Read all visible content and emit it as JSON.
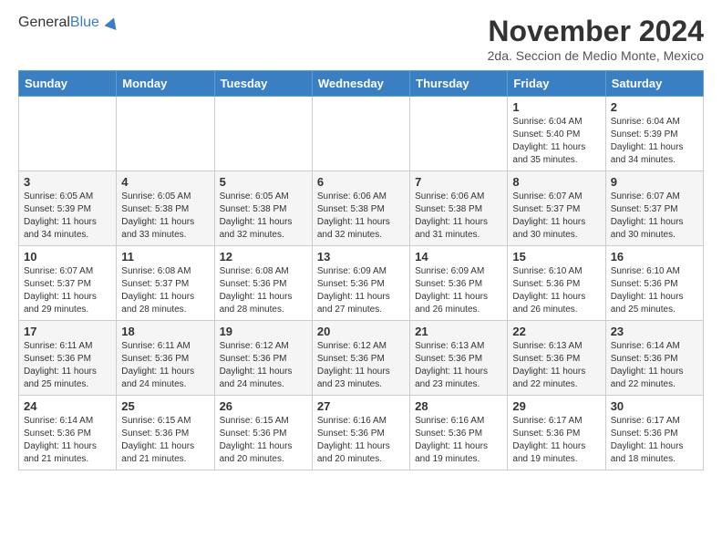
{
  "logo": {
    "general": "General",
    "blue": "Blue"
  },
  "header": {
    "month_title": "November 2024",
    "subtitle": "2da. Seccion de Medio Monte, Mexico"
  },
  "weekdays": [
    "Sunday",
    "Monday",
    "Tuesday",
    "Wednesday",
    "Thursday",
    "Friday",
    "Saturday"
  ],
  "weeks": [
    [
      {
        "day": "",
        "info": ""
      },
      {
        "day": "",
        "info": ""
      },
      {
        "day": "",
        "info": ""
      },
      {
        "day": "",
        "info": ""
      },
      {
        "day": "",
        "info": ""
      },
      {
        "day": "1",
        "info": "Sunrise: 6:04 AM\nSunset: 5:40 PM\nDaylight: 11 hours\nand 35 minutes."
      },
      {
        "day": "2",
        "info": "Sunrise: 6:04 AM\nSunset: 5:39 PM\nDaylight: 11 hours\nand 34 minutes."
      }
    ],
    [
      {
        "day": "3",
        "info": "Sunrise: 6:05 AM\nSunset: 5:39 PM\nDaylight: 11 hours\nand 34 minutes."
      },
      {
        "day": "4",
        "info": "Sunrise: 6:05 AM\nSunset: 5:38 PM\nDaylight: 11 hours\nand 33 minutes."
      },
      {
        "day": "5",
        "info": "Sunrise: 6:05 AM\nSunset: 5:38 PM\nDaylight: 11 hours\nand 32 minutes."
      },
      {
        "day": "6",
        "info": "Sunrise: 6:06 AM\nSunset: 5:38 PM\nDaylight: 11 hours\nand 32 minutes."
      },
      {
        "day": "7",
        "info": "Sunrise: 6:06 AM\nSunset: 5:38 PM\nDaylight: 11 hours\nand 31 minutes."
      },
      {
        "day": "8",
        "info": "Sunrise: 6:07 AM\nSunset: 5:37 PM\nDaylight: 11 hours\nand 30 minutes."
      },
      {
        "day": "9",
        "info": "Sunrise: 6:07 AM\nSunset: 5:37 PM\nDaylight: 11 hours\nand 30 minutes."
      }
    ],
    [
      {
        "day": "10",
        "info": "Sunrise: 6:07 AM\nSunset: 5:37 PM\nDaylight: 11 hours\nand 29 minutes."
      },
      {
        "day": "11",
        "info": "Sunrise: 6:08 AM\nSunset: 5:37 PM\nDaylight: 11 hours\nand 28 minutes."
      },
      {
        "day": "12",
        "info": "Sunrise: 6:08 AM\nSunset: 5:36 PM\nDaylight: 11 hours\nand 28 minutes."
      },
      {
        "day": "13",
        "info": "Sunrise: 6:09 AM\nSunset: 5:36 PM\nDaylight: 11 hours\nand 27 minutes."
      },
      {
        "day": "14",
        "info": "Sunrise: 6:09 AM\nSunset: 5:36 PM\nDaylight: 11 hours\nand 26 minutes."
      },
      {
        "day": "15",
        "info": "Sunrise: 6:10 AM\nSunset: 5:36 PM\nDaylight: 11 hours\nand 26 minutes."
      },
      {
        "day": "16",
        "info": "Sunrise: 6:10 AM\nSunset: 5:36 PM\nDaylight: 11 hours\nand 25 minutes."
      }
    ],
    [
      {
        "day": "17",
        "info": "Sunrise: 6:11 AM\nSunset: 5:36 PM\nDaylight: 11 hours\nand 25 minutes."
      },
      {
        "day": "18",
        "info": "Sunrise: 6:11 AM\nSunset: 5:36 PM\nDaylight: 11 hours\nand 24 minutes."
      },
      {
        "day": "19",
        "info": "Sunrise: 6:12 AM\nSunset: 5:36 PM\nDaylight: 11 hours\nand 24 minutes."
      },
      {
        "day": "20",
        "info": "Sunrise: 6:12 AM\nSunset: 5:36 PM\nDaylight: 11 hours\nand 23 minutes."
      },
      {
        "day": "21",
        "info": "Sunrise: 6:13 AM\nSunset: 5:36 PM\nDaylight: 11 hours\nand 23 minutes."
      },
      {
        "day": "22",
        "info": "Sunrise: 6:13 AM\nSunset: 5:36 PM\nDaylight: 11 hours\nand 22 minutes."
      },
      {
        "day": "23",
        "info": "Sunrise: 6:14 AM\nSunset: 5:36 PM\nDaylight: 11 hours\nand 22 minutes."
      }
    ],
    [
      {
        "day": "24",
        "info": "Sunrise: 6:14 AM\nSunset: 5:36 PM\nDaylight: 11 hours\nand 21 minutes."
      },
      {
        "day": "25",
        "info": "Sunrise: 6:15 AM\nSunset: 5:36 PM\nDaylight: 11 hours\nand 21 minutes."
      },
      {
        "day": "26",
        "info": "Sunrise: 6:15 AM\nSunset: 5:36 PM\nDaylight: 11 hours\nand 20 minutes."
      },
      {
        "day": "27",
        "info": "Sunrise: 6:16 AM\nSunset: 5:36 PM\nDaylight: 11 hours\nand 20 minutes."
      },
      {
        "day": "28",
        "info": "Sunrise: 6:16 AM\nSunset: 5:36 PM\nDaylight: 11 hours\nand 19 minutes."
      },
      {
        "day": "29",
        "info": "Sunrise: 6:17 AM\nSunset: 5:36 PM\nDaylight: 11 hours\nand 19 minutes."
      },
      {
        "day": "30",
        "info": "Sunrise: 6:17 AM\nSunset: 5:36 PM\nDaylight: 11 hours\nand 18 minutes."
      }
    ]
  ]
}
